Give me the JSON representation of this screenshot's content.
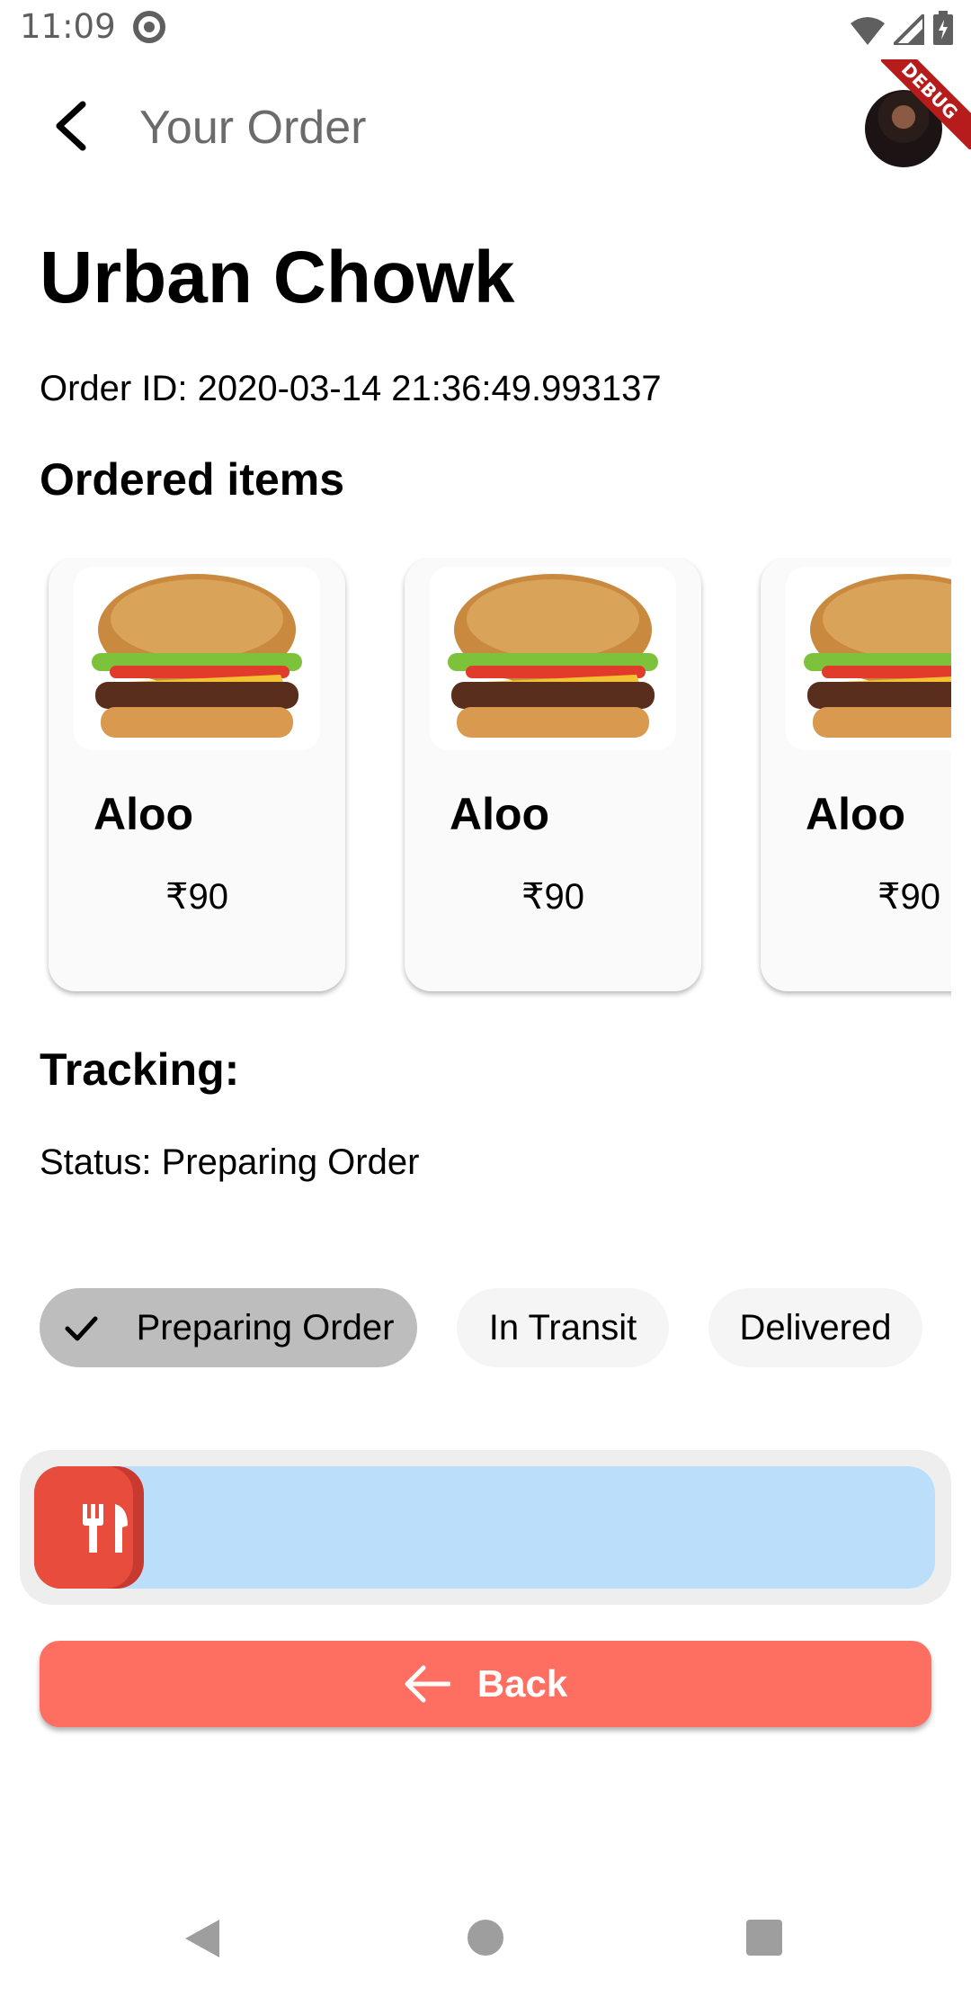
{
  "status_bar": {
    "time": "11:09"
  },
  "app_bar": {
    "title": "Your Order",
    "debug_label": "DEBUG"
  },
  "restaurant": {
    "name": "Urban Chowk",
    "order_id": "Order ID: 2020-03-14 21:36:49.993137"
  },
  "ordered_items": {
    "heading": "Ordered items",
    "items": [
      {
        "name": "Aloo",
        "price": "₹90"
      },
      {
        "name": "Aloo",
        "price": "₹90"
      },
      {
        "name": "Aloo",
        "price": "₹90"
      }
    ]
  },
  "tracking": {
    "heading": "Tracking:",
    "status": "Status: Preparing Order",
    "steps": [
      {
        "label": "Preparing Order",
        "selected": true
      },
      {
        "label": "In Transit",
        "selected": false
      },
      {
        "label": "Delivered",
        "selected": false
      }
    ],
    "progress_fraction": 0
  },
  "actions": {
    "back_label": "Back"
  },
  "colors": {
    "accent": "#ff6f61",
    "track": "#bbdefb",
    "thumb": "#e74c3c",
    "chip_selected": "#bdbdbd"
  },
  "icons": {
    "back": "arrow-back-icon",
    "fork_knife": "restaurant-icon",
    "check": "check-icon"
  }
}
